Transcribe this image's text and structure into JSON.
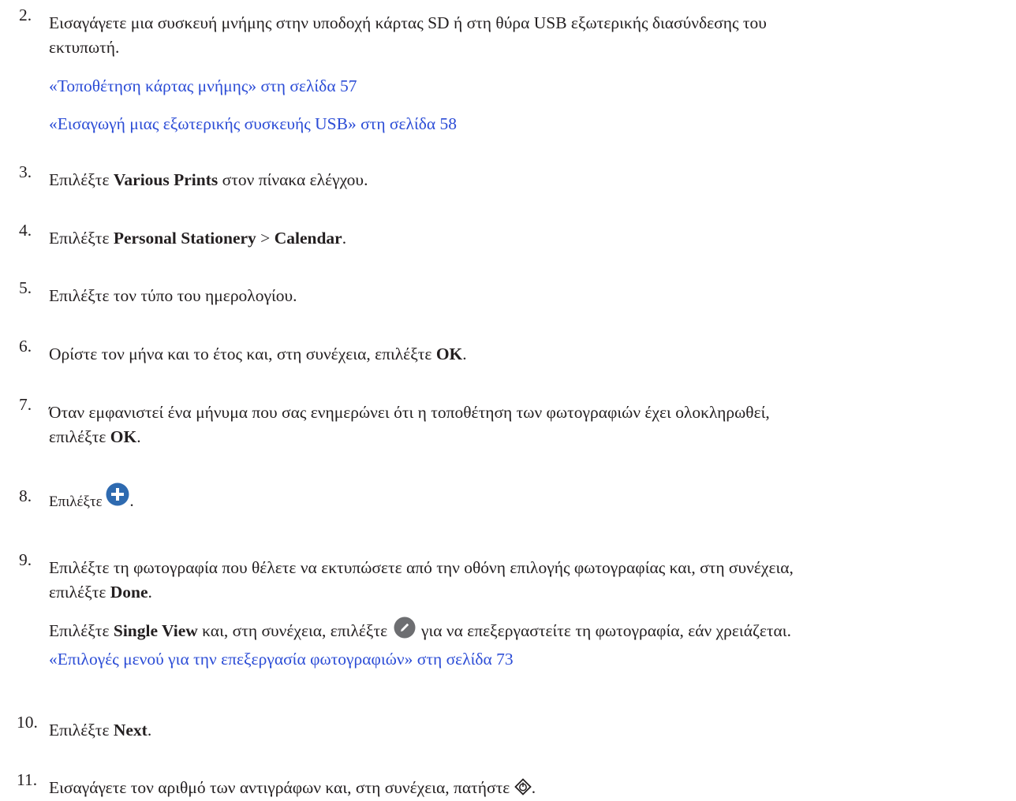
{
  "steps": [
    {
      "num": "2.",
      "line1": "Εισαγάγετε μια συσκευή μνήμης στην υποδοχή κάρτας SD ή στη θύρα USB εξωτερικής διασύνδεσης του",
      "line2": "εκτυπωτή.",
      "links": [
        "«Τοποθέτηση κάρτας μνήμης» στη σελίδα 57",
        "«Εισαγωγή μιας εξωτερικής συσκευής USB» στη σελίδα 58"
      ]
    },
    {
      "num": "3.",
      "pre": "Επιλέξτε ",
      "bold": "Various Prints",
      "post": " στον πίνακα ελέγχου."
    },
    {
      "num": "4.",
      "pre": "Επιλέξτε ",
      "bold1": "Personal Stationery",
      "mid": " > ",
      "bold2": "Calendar",
      "post": "."
    },
    {
      "num": "5.",
      "text": "Επιλέξτε τον τύπο του ημερολογίου."
    },
    {
      "num": "6.",
      "pre": "Ορίστε τον μήνα και το έτος και, στη συνέχεια, επιλέξτε ",
      "bold": "OK",
      "post": "."
    },
    {
      "num": "7.",
      "line1": "Όταν εμφανιστεί ένα μήνυμα που σας ενημερώνει ότι η τοποθέτηση των φωτογραφιών έχει ολοκληρωθεί,",
      "pre2": "επιλέξτε ",
      "bold": "OK",
      "post2": "."
    },
    {
      "num": "8.",
      "pre": "Επιλέξτε ",
      "post": ".",
      "icon": "plus-circle-icon"
    },
    {
      "num": "9.",
      "line1": "Επιλέξτε τη φωτογραφία που θέλετε να εκτυπώσετε από την οθόνη επιλογής φωτογραφίας και, στη συνέχεια,",
      "pre2": "επιλέξτε ",
      "bold": "Done",
      "post2": ".",
      "sub_pre": "Επιλέξτε ",
      "sub_bold": "Single View",
      "sub_mid": " και, στη συνέχεια, επιλέξτε ",
      "sub_post": " για να επεξεργαστείτε τη φωτογραφία, εάν χρειάζεται.",
      "sub_icon": "pencil-circle-icon",
      "link": "«Επιλογές μενού για την επεξεργασία φωτογραφιών» στη σελίδα 73"
    },
    {
      "num": "10.",
      "pre": "Επιλέξτε ",
      "bold": "Next",
      "post": "."
    },
    {
      "num": "11.",
      "pre": "Εισαγάγετε τον αριθμό των αντιγράφων και, στη συνέχεια, πατήστε ",
      "post": ".",
      "icon": "start-diamond-icon"
    }
  ],
  "colors": {
    "text": "#231f20",
    "link": "#2b4cd6",
    "icon": "#2e6ab0"
  }
}
